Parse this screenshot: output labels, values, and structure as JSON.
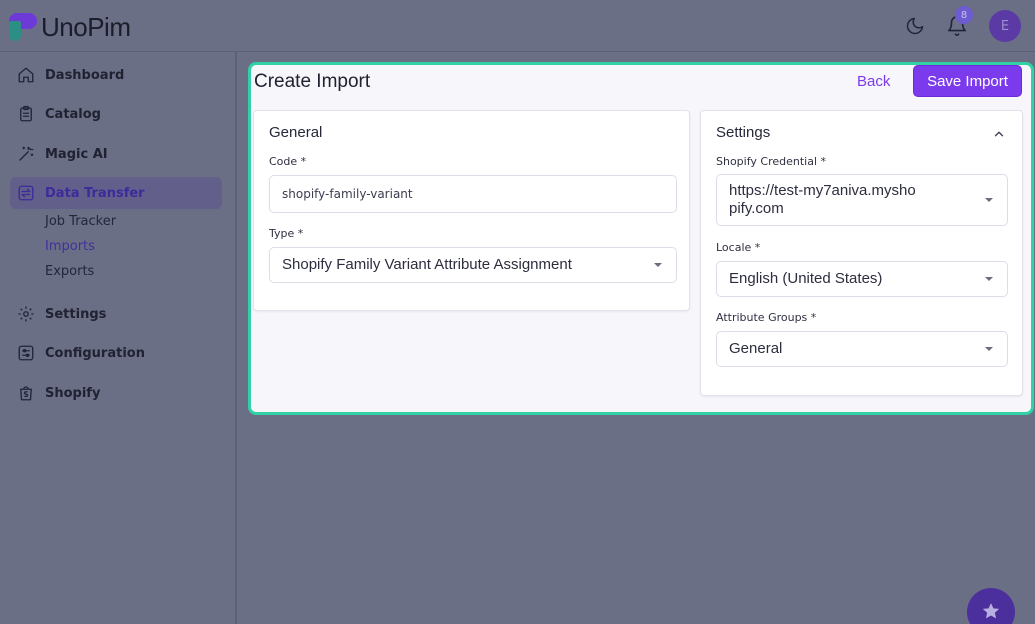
{
  "brand": {
    "name": "UnoPim"
  },
  "header": {
    "notification_count": "8",
    "avatar_initial": "E"
  },
  "sidebar": {
    "items": [
      {
        "label": "Dashboard",
        "icon": "home-icon"
      },
      {
        "label": "Catalog",
        "icon": "clipboard-icon"
      },
      {
        "label": "Magic AI",
        "icon": "magic-wand-icon"
      },
      {
        "label": "Data Transfer",
        "icon": "transfer-icon",
        "active": true
      },
      {
        "label": "Settings",
        "icon": "gear-icon"
      },
      {
        "label": "Configuration",
        "icon": "sliders-icon"
      },
      {
        "label": "Shopify",
        "icon": "shopify-bag-icon"
      }
    ],
    "sub_items": [
      {
        "label": "Job Tracker"
      },
      {
        "label": "Imports",
        "active": true
      },
      {
        "label": "Exports"
      }
    ]
  },
  "page": {
    "title": "Create Import",
    "back_label": "Back",
    "save_label": "Save Import"
  },
  "general": {
    "title": "General",
    "code_label": "Code *",
    "code_value": "shopify-family-variant",
    "type_label": "Type *",
    "type_value": "Shopify Family Variant Attribute Assignment"
  },
  "settings": {
    "title": "Settings",
    "credential_label": "Shopify Credential *",
    "credential_value": "https://test-my7aniva.myshopify.com",
    "locale_label": "Locale *",
    "locale_value": "English (United States)",
    "attribute_groups_label": "Attribute Groups *",
    "attribute_groups_value": "General"
  },
  "colors": {
    "accent": "#7c3aed",
    "highlight_border": "#2fd1a5",
    "overlay": "#6b6f86"
  }
}
